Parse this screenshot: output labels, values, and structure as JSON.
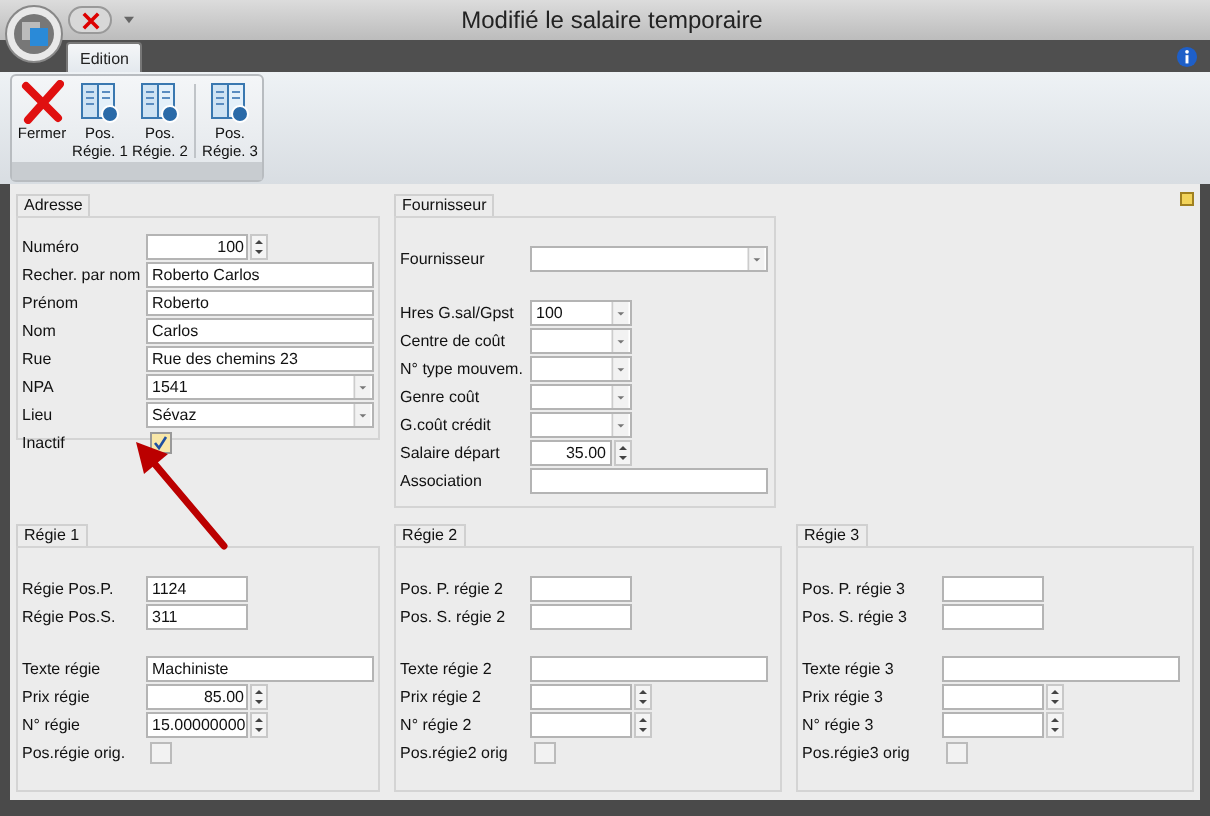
{
  "window": {
    "title": "Modifié le salaire temporaire"
  },
  "tabs": [
    {
      "label": "Edition",
      "selected": true
    }
  ],
  "ribbon": {
    "button_groups": [
      [
        {
          "label": "Fermer",
          "kind": "close"
        },
        {
          "label": "Pos. Régie. 1",
          "kind": "book"
        },
        {
          "label": "Pos. Régie. 2",
          "kind": "book"
        }
      ],
      [
        {
          "label": "Pos. Régie. 3",
          "kind": "book"
        }
      ]
    ]
  },
  "top_groups": [
    {
      "title": "Adresse",
      "blocks": [
        [
          {
            "label": "Numéro",
            "kind": "spin",
            "value": "100"
          },
          {
            "label": "Recher. par nom",
            "kind": "text",
            "value": "Roberto Carlos"
          },
          {
            "label": "Prénom",
            "kind": "text",
            "value": "Roberto"
          },
          {
            "label": "Nom",
            "kind": "text",
            "value": "Carlos"
          },
          {
            "label": "Rue",
            "kind": "text",
            "value": "Rue des chemins 23"
          },
          {
            "label": "NPA",
            "kind": "combo",
            "value": "1541"
          },
          {
            "label": "Lieu",
            "kind": "combo",
            "value": "Sévaz"
          },
          {
            "label": "Inactif",
            "kind": "check",
            "checked": true
          }
        ]
      ]
    },
    {
      "title": "Fournisseur",
      "blocks": [
        [
          {
            "label": "Fournisseur",
            "kind": "combo"
          }
        ],
        [
          {
            "label": "Hres G.sal/Gpst",
            "kind": "short-combo",
            "value": "100"
          },
          {
            "label": "Centre de coût",
            "kind": "short-combo"
          },
          {
            "label": "N° type mouvem.",
            "kind": "short-combo"
          },
          {
            "label": "Genre coût",
            "kind": "short-combo"
          },
          {
            "label": "G.coût crédit",
            "kind": "short-combo"
          },
          {
            "label": "Salaire départ",
            "kind": "small-spin",
            "value": "35.00"
          },
          {
            "label": "Association",
            "kind": "text"
          }
        ]
      ]
    }
  ],
  "bottom_groups": [
    {
      "title": "Régie 1",
      "blocks": [
        [
          {
            "label": "Régie Pos.P.",
            "kind": "short-text",
            "value": "1124"
          },
          {
            "label": "Régie Pos.S.",
            "kind": "short-text",
            "value": "311"
          }
        ],
        [
          {
            "label": "Texte régie",
            "kind": "text",
            "value": "Machiniste"
          },
          {
            "label": "Prix régie",
            "kind": "spin",
            "value": "85.00"
          },
          {
            "label": "N° régie",
            "kind": "spin",
            "value": "15.00000000"
          },
          {
            "label": "Pos.régie orig.",
            "kind": "check",
            "checked": false
          }
        ]
      ]
    },
    {
      "title": "Régie 2",
      "blocks": [
        [
          {
            "label": "Pos. P. régie 2",
            "kind": "short-text"
          },
          {
            "label": "Pos. S. régie 2",
            "kind": "short-text"
          }
        ],
        [
          {
            "label": "Texte régie 2",
            "kind": "text"
          },
          {
            "label": "Prix régie 2",
            "kind": "spin"
          },
          {
            "label": "N° régie 2",
            "kind": "spin"
          },
          {
            "label": "Pos.régie2 orig",
            "kind": "check",
            "checked": false
          }
        ]
      ]
    },
    {
      "title": "Régie 3",
      "blocks": [
        [
          {
            "label": "Pos. P. régie 3",
            "kind": "short-text"
          },
          {
            "label": "Pos. S. régie 3",
            "kind": "short-text"
          }
        ],
        [
          {
            "label": "Texte régie 3",
            "kind": "text"
          },
          {
            "label": "Prix régie 3",
            "kind": "spin"
          },
          {
            "label": "N° régie 3",
            "kind": "spin"
          },
          {
            "label": "Pos.régie3 orig",
            "kind": "check",
            "checked": false
          }
        ]
      ]
    }
  ]
}
